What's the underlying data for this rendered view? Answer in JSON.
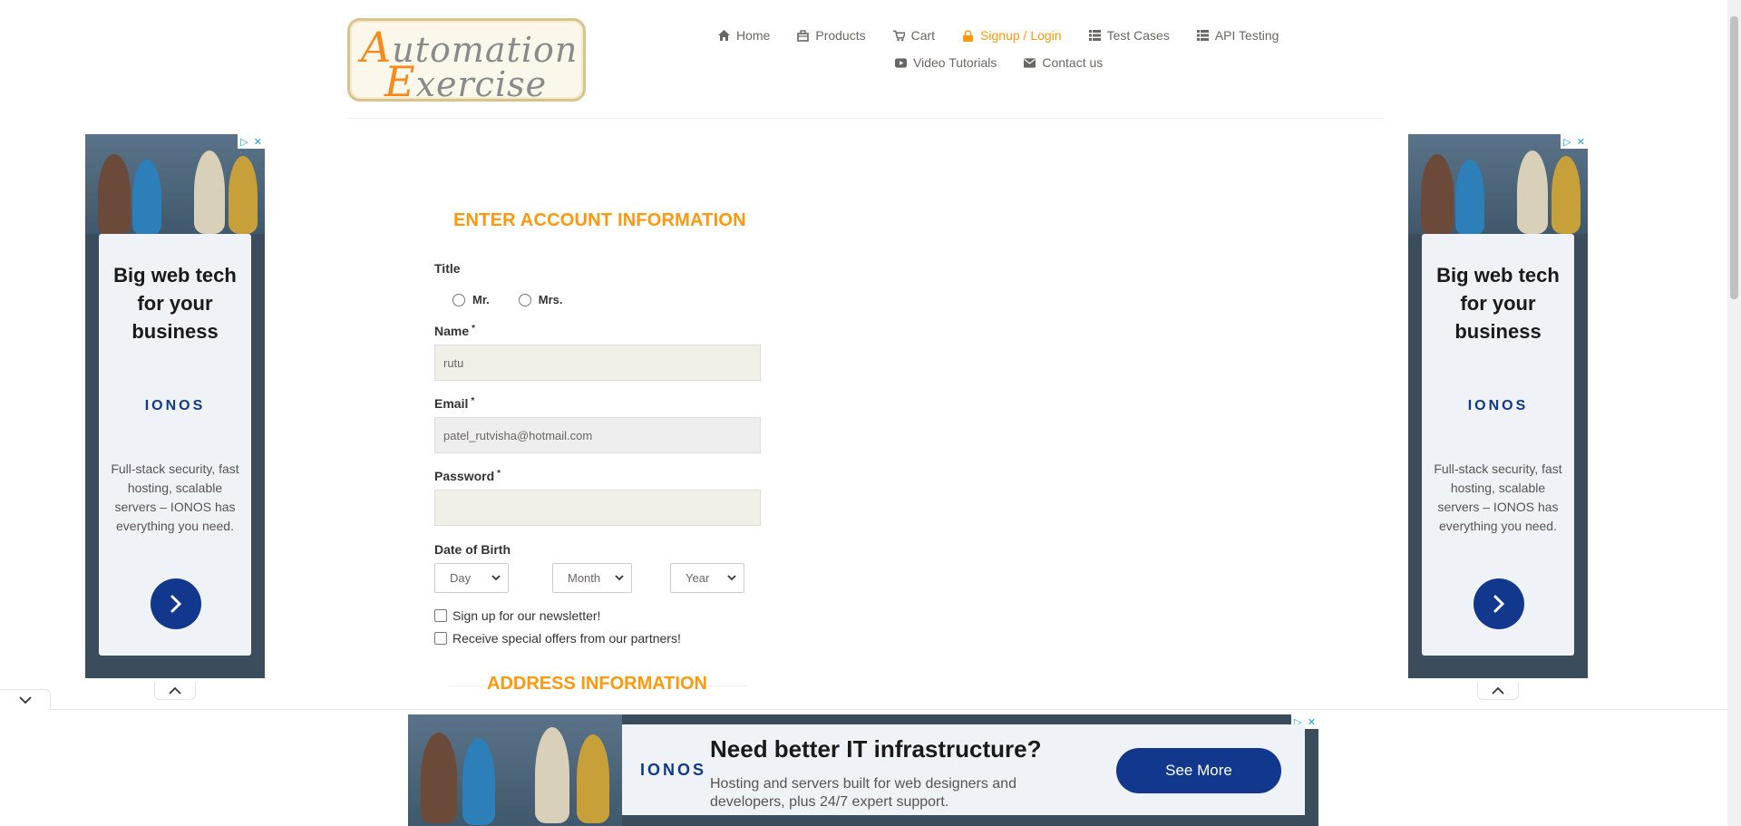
{
  "logo": {
    "line1_cap": "A",
    "line1_rest": "utomation",
    "line2_cap": "E",
    "line2_rest": "xercise"
  },
  "nav": {
    "items": [
      {
        "label": "Home",
        "icon": "home-icon"
      },
      {
        "label": "Products",
        "icon": "products-icon"
      },
      {
        "label": "Cart",
        "icon": "cart-icon"
      },
      {
        "label": "Signup / Login",
        "icon": "lock-icon",
        "active": true
      },
      {
        "label": "Test Cases",
        "icon": "list-icon"
      },
      {
        "label": "API Testing",
        "icon": "list-icon"
      },
      {
        "label": "Video Tutorials",
        "icon": "youtube-icon"
      },
      {
        "label": "Contact us",
        "icon": "envelope-icon"
      }
    ]
  },
  "form": {
    "title": "ENTER ACCOUNT INFORMATION",
    "title_label": "Title",
    "title_options": [
      "Mr.",
      "Mrs."
    ],
    "name_label": "Name",
    "name_value": "rutu",
    "email_label": "Email",
    "email_value": "patel_rutvisha@hotmail.com",
    "password_label": "Password",
    "password_value": "",
    "required_mark": "*",
    "dob_label": "Date of Birth",
    "dob_day": "Day",
    "dob_month": "Month",
    "dob_year": "Year",
    "newsletter_label": "Sign up for our newsletter!",
    "offers_label": "Receive special offers from our partners!",
    "address_title": "ADDRESS INFORMATION"
  },
  "side_ad": {
    "headline": "Big web tech for your business",
    "brand": "IONOS",
    "body": "Full-stack security, fast hosting, scalable servers – IONOS has everything you need."
  },
  "bottom_ad": {
    "brand": "IONOS",
    "headline": "Need better IT infrastructure?",
    "body": "Hosting and servers built for web designers and developers, plus 24/7 expert support.",
    "cta": "See More"
  },
  "colors": {
    "accent": "#fe980f",
    "ionos_blue": "#11388c",
    "text": "#696763"
  }
}
